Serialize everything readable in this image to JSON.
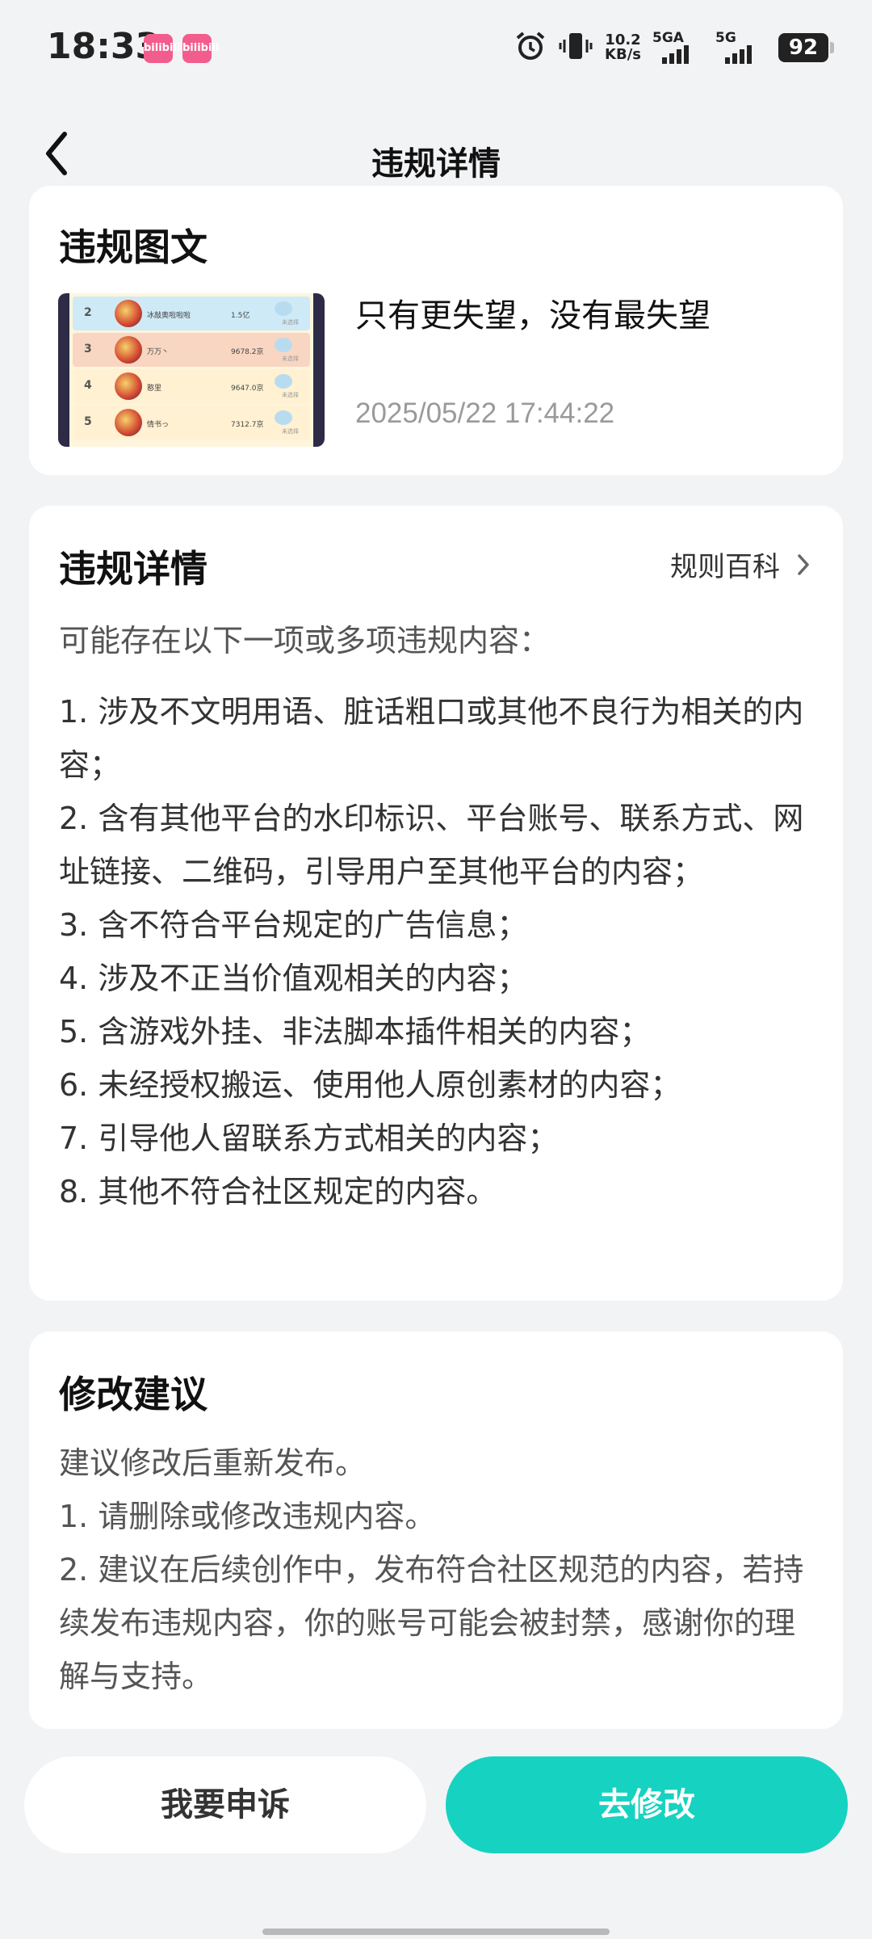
{
  "status_bar": {
    "time": "18:33",
    "app_badge": "bilibili",
    "net_speed_value": "10.2",
    "net_speed_unit": "KB/s",
    "signal1_label": "5GA",
    "signal2_label": "5G",
    "battery": "92"
  },
  "header": {
    "title": "违规详情"
  },
  "post_card": {
    "title": "违规图文",
    "post_text": "只有更失望，没有最失望",
    "timestamp": "2025/05/22 17:44:22",
    "thumbnail_rows": [
      {
        "rank": "2",
        "name": "冰敲奥啦啦啦",
        "value": "1.5亿",
        "tag": "未选择",
        "bg": "#cfeaf7"
      },
      {
        "rank": "3",
        "name": "万万丶",
        "value": "9678.2京",
        "tag": "未选择",
        "bg": "#f9d6c2"
      },
      {
        "rank": "4",
        "name": "憨里",
        "value": "9647.0京",
        "tag": "未选择",
        "bg": "#fff1d2"
      },
      {
        "rank": "5",
        "name": "情书っ",
        "value": "7312.7京",
        "tag": "未选择",
        "bg": "#fff1d2"
      }
    ]
  },
  "detail_card": {
    "title": "违规详情",
    "rules_link": "规则百科",
    "intro": "可能存在以下一项或多项违规内容：",
    "items": [
      "1. 涉及不文明用语、脏话粗口或其他不良行为相关的内容；",
      "2. 含有其他平台的水印标识、平台账号、联系方式、网址链接、二维码，引导用户至其他平台的内容；",
      "3. 含不符合平台规定的广告信息；",
      "4. 涉及不正当价值观相关的内容；",
      "5. 含游戏外挂、非法脚本插件相关的内容；",
      "6. 未经授权搬运、使用他人原创素材的内容；",
      "7. 引导他人留联系方式相关的内容；",
      "8. 其他不符合社区规定的内容。"
    ]
  },
  "suggest_card": {
    "title": "修改建议",
    "lines": [
      "建议修改后重新发布。",
      "1. 请删除或修改违规内容。",
      "2. 建议在后续创作中，发布符合社区规范的内容，若持续发布违规内容，你的账号可能会被封禁，感谢你的理解与支持。"
    ]
  },
  "actions": {
    "appeal": "我要申诉",
    "modify": "去修改"
  },
  "colors": {
    "accent": "#16d2c1",
    "background": "#f2f3f5",
    "badge": "#f25d8e"
  }
}
